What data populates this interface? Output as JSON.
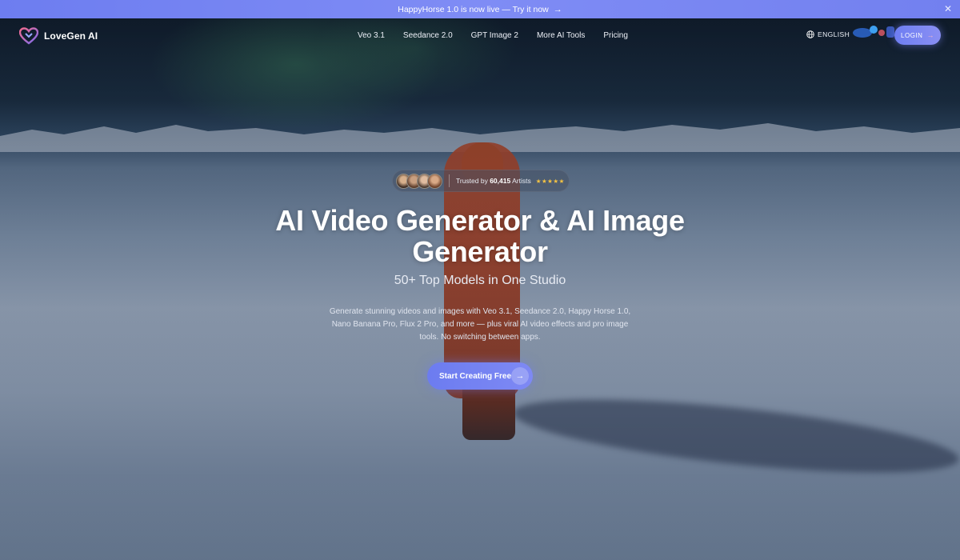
{
  "announcement": {
    "text": "HappyHorse 1.0 is now live — Try it now",
    "arrow": "→",
    "close": "✕"
  },
  "brand": {
    "name": "LoveGen AI",
    "accent": "#6d7df0"
  },
  "nav": {
    "links": [
      "Veo 3.1",
      "Seedance 2.0",
      "GPT Image 2",
      "More AI Tools",
      "Pricing"
    ],
    "language": "ENGLISH",
    "login": "LOGIN",
    "login_arrow": "→"
  },
  "hero": {
    "trusted_prefix": "Trusted by ",
    "trusted_count": "60,415",
    "trusted_suffix": " Artists",
    "stars": "★★★★★",
    "headline_line1": "AI Video Generator & AI Image",
    "headline_line2": "Generator",
    "subheadline": "50+ Top Models in One Studio",
    "description": "Generate stunning videos and images with Veo 3.1, Seedance 2.0, Happy Horse 1.0, Nano Banana Pro, Flux 2 Pro, and more — plus viral AI video effects and pro image tools. No switching between apps.",
    "cta_label": "Start Creating Free",
    "cta_arrow": "→"
  },
  "icons": {
    "logo": "heart-logo-icon",
    "language": "globe-icon",
    "close": "close-icon",
    "cta": "arrow-right-icon"
  }
}
